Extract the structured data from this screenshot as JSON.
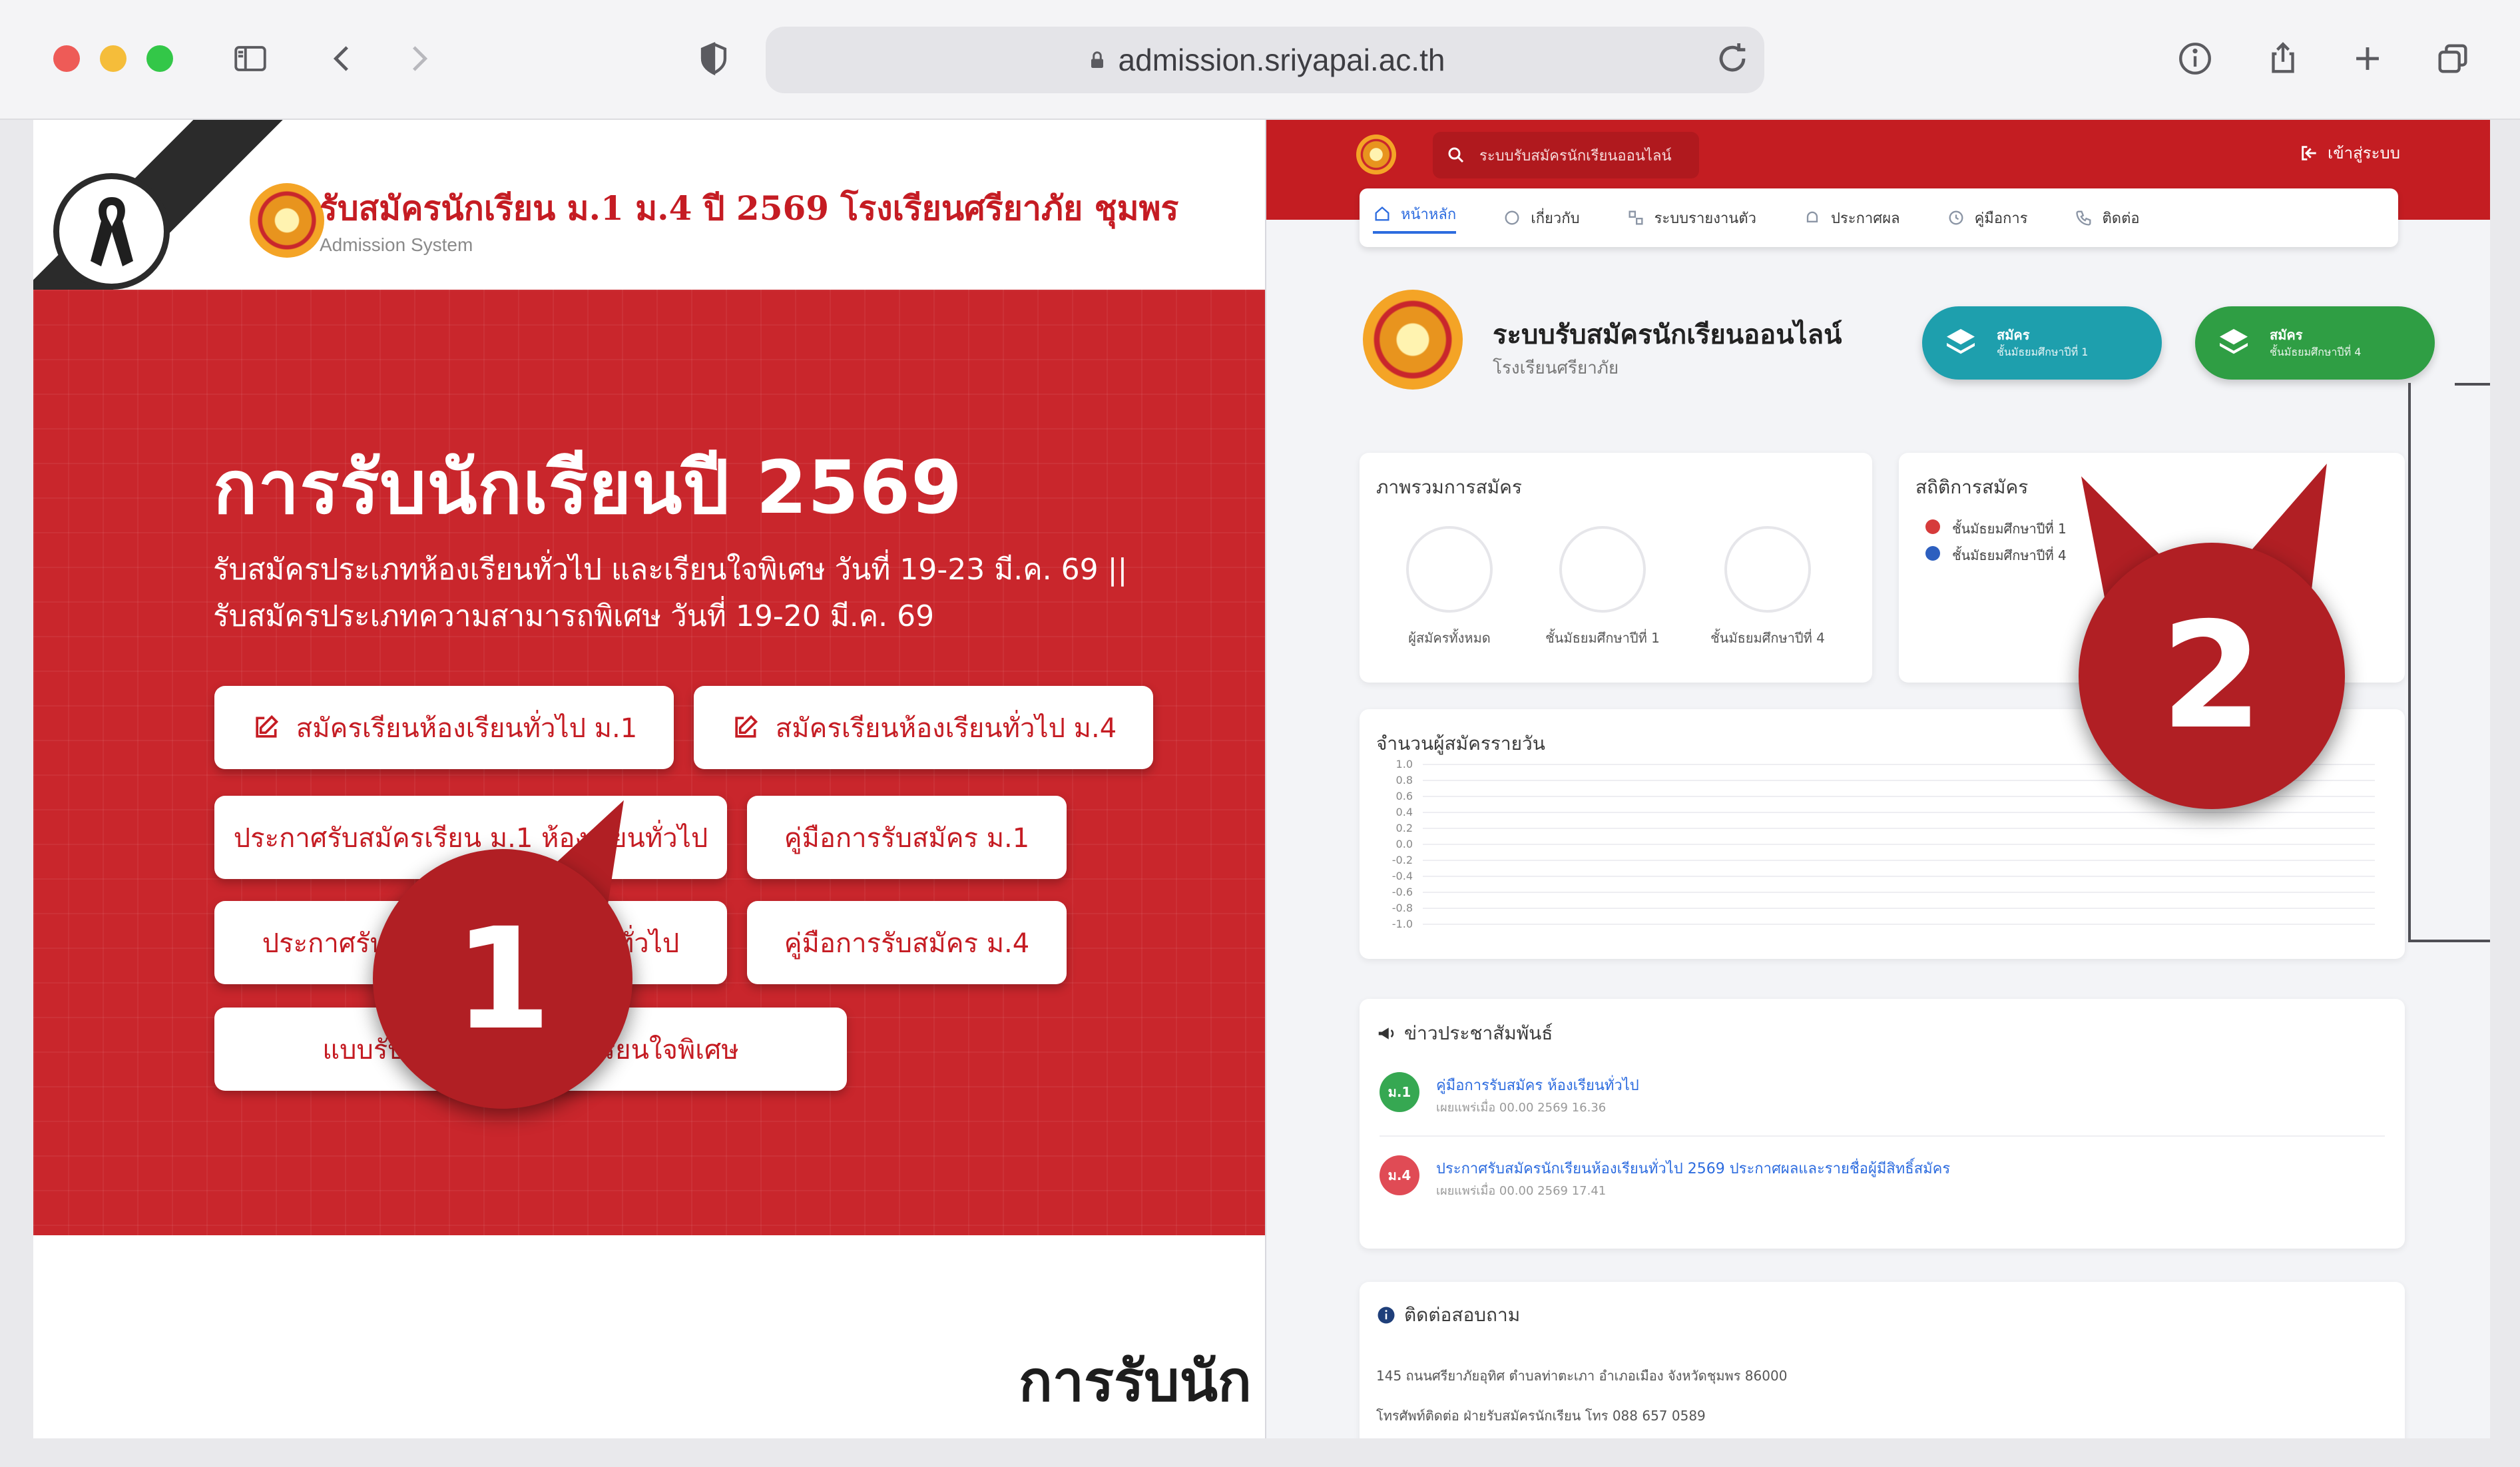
{
  "browser": {
    "url": "admission.sriyapai.ac.th"
  },
  "left_site": {
    "title": "รับสมัครนักเรียน ม.1 ม.4 ปี 2569 โรงเรียนศรียาภัย ชุมพร",
    "subtitle": "Admission System",
    "hero": {
      "heading": "การรับนักเรียนปี 2569",
      "line1": "รับสมัครประเภทห้องเรียนทั่วไป และเรียนใจพิเศษ วันที่ 19-23 มี.ค. 69 ||",
      "line2": "รับสมัครประเภทความสามารถพิเศษ วันที่ 19-20 มี.ค. 69"
    },
    "buttons": {
      "apply_m1": "สมัครเรียนห้องเรียนทั่วไป ม.1",
      "apply_m4": "สมัครเรียนห้องเรียนทั่วไป ม.4",
      "announce_m1": "ประกาศรับสมัครเรียน ม.1 ห้องเรียนทั่วไป",
      "manual_m1": "คู่มือการรับสมัคร ม.1",
      "announce_m4": "ประกาศรับสมัคร ม.4 ห้องเรียนทั่วไป",
      "manual_m4": "คู่มือการรับสมัคร ม.4",
      "form_special": "แบบรับสมัครห้องเรียนที่เรียนใจพิเศษ"
    },
    "bottom_heading": "การรับนัก"
  },
  "right_app": {
    "search_placeholder": "ระบบรับสมัครนักเรียนออนไลน์",
    "login_label": "เข้าสู่ระบบ",
    "nav": [
      "หน้าหลัก",
      "เกี่ยวกับ",
      "ระบบรายงานตัว",
      "ประกาศผล",
      "คู่มือการ",
      "ติดต่อ"
    ],
    "title": "ระบบรับสมัครนักเรียนออนไลน์",
    "subtitle": "โรงเรียนศรียาภัย",
    "pill_teal": {
      "label": "สมัคร",
      "sub": "ชั้นมัธยมศึกษาปีที่ 1"
    },
    "pill_green": {
      "label": "สมัคร",
      "sub": "ชั้นมัธยมศึกษาปีที่ 4"
    },
    "stats": {
      "title": "ภาพรวมการสมัคร",
      "rings": [
        "ผู้สมัครทั้งหมด",
        "ชั้นมัธยมศึกษาปีที่ 1",
        "ชั้นมัธยมศึกษาปีที่ 4"
      ]
    },
    "legend": {
      "title": "สถิติการสมัคร",
      "items": [
        "ชั้นมัธยมศึกษาปีที่ 1",
        "ชั้นมัธยมศึกษาปีที่ 4"
      ],
      "colors": [
        "#d63b3b",
        "#2d5fbf"
      ]
    },
    "chart": {
      "title": "จำนวนผู้สมัครรายวัน",
      "yticks": [
        "1.0",
        "0.8",
        "0.6",
        "0.4",
        "0.2",
        "0.0",
        "-0.2",
        "-0.4",
        "-0.6",
        "-0.8",
        "-1.0"
      ]
    },
    "news": {
      "title": "ข่าวประชาสัมพันธ์",
      "items": [
        {
          "badge": "ม.1",
          "title": "คู่มือการรับสมัคร ห้องเรียนทั่วไป",
          "meta": "เผยแพร่เมื่อ 00.00 2569 16.36",
          "color": "#36a852"
        },
        {
          "badge": "ม.4",
          "title": "ประกาศรับสมัครนักเรียนห้องเรียนทั่วไป 2569 ประกาศผลและรายชื่อผู้มีสิทธิ์สมัคร",
          "meta": "เผยแพร่เมื่อ 00.00 2569 17.41",
          "color": "#e04b55"
        }
      ]
    },
    "contact": {
      "title": "ติดต่อสอบถาม",
      "line1": "145 ถนนศรียาภัยอุทิศ ตำบลท่าตะเภา อำเภอเมือง จังหวัดชุมพร 86000",
      "line2": "โทรศัพท์ติดต่อ ฝ่ายรับสมัครนักเรียน โทร 088 657 0589"
    }
  },
  "markers": {
    "m1": "1",
    "m2": "2"
  },
  "colors": {
    "brand_red": "#c9262c",
    "marker_red": "#b11f24",
    "teal": "#1e9fad",
    "green": "#2f9e44",
    "link_blue": "#2d6cdf"
  }
}
